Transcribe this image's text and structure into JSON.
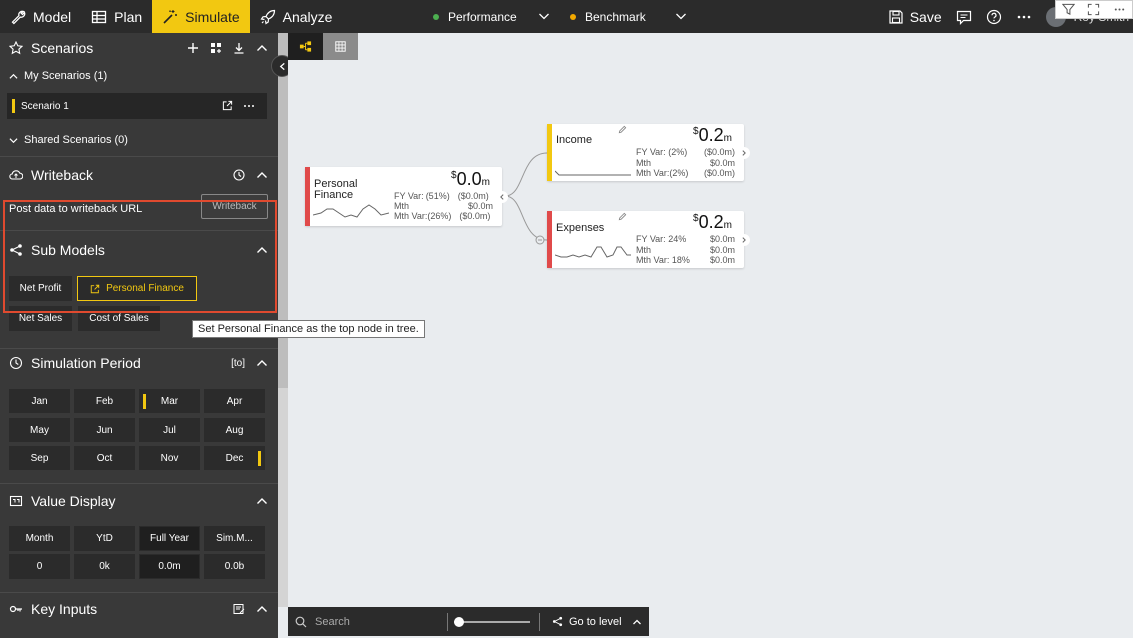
{
  "topnav": {
    "model_label": "Model",
    "plan_label": "Plan",
    "simulate_label": "Simulate",
    "analyze_label": "Analyze",
    "performance_label": "Performance",
    "benchmark_label": "Benchmark",
    "save_label": "Save",
    "user_name": "Roy Smith"
  },
  "colors": {
    "accent": "#f2c811",
    "sidebar": "#393939",
    "topbar": "#2b2b2b",
    "canvas": "#e9ecef",
    "expense": "#e04a4a",
    "income": "#f2c811",
    "performance_dot": "#4caf50",
    "benchmark_dot": "#f2a900"
  },
  "sidebar": {
    "scenarios_title": "Scenarios",
    "my_scenarios": "My Scenarios (1)",
    "scenario_1": "Scenario 1",
    "shared_scenarios": "Shared Scenarios (0)",
    "writeback_title": "Writeback",
    "writeback_desc": "Post data to writeback URL",
    "writeback_button": "Writeback",
    "submodels_title": "Sub Models",
    "submodels": [
      "Net Profit",
      "Personal Finance",
      "Net Sales",
      "Cost of Sales"
    ],
    "tooltip": "Set Personal Finance as the top node in tree.",
    "simulation_title": "Simulation Period",
    "simulation_tag": "[to]",
    "months": [
      "Jan",
      "Feb",
      "Mar",
      "Apr",
      "May",
      "Jun",
      "Jul",
      "Aug",
      "Sep",
      "Oct",
      "Nov",
      "Dec"
    ],
    "value_display_title": "Value Display",
    "value_display_headers": [
      "Month",
      "YtD",
      "Full Year",
      "Sim.M..."
    ],
    "value_display_values": [
      "0",
      "0k",
      "0.0m",
      "0.0b"
    ],
    "key_inputs_title": "Key Inputs"
  },
  "nodes": {
    "personal_finance": {
      "name_line1": "Personal",
      "name_line2": "Finance",
      "value": "0.0",
      "unit": "m",
      "currency": "$",
      "fy_label": "FY Var:",
      "fy_pct": "(51%)",
      "fy_val": "($0.0m)",
      "mth_label": "Mth",
      "mth_val": "$0.0m",
      "mthvar_label": "Mth Var:",
      "mthvar_pct": "(26%)",
      "mthvar_val": "($0.0m)"
    },
    "income": {
      "name": "Income",
      "value": "0.2",
      "unit": "m",
      "currency": "$",
      "fy_label": "FY Var:",
      "fy_pct": "(2%)",
      "fy_val": "($0.0m)",
      "mth_label": "Mth",
      "mth_val": "$0.0m",
      "mthvar_label": "Mth Var:",
      "mthvar_pct": "(2%)",
      "mthvar_val": "($0.0m)"
    },
    "expenses": {
      "name": "Expenses",
      "value": "0.2",
      "unit": "m",
      "currency": "$",
      "fy_label": "FY Var:",
      "fy_pct": "24%",
      "fy_val": "$0.0m",
      "mth_label": "Mth",
      "mth_val": "$0.0m",
      "mthvar_label": "Mth Var:",
      "mthvar_pct": "18%",
      "mthvar_val": "$0.0m"
    }
  },
  "bottombar": {
    "search_placeholder": "Search",
    "zoom_level": 0,
    "go_to_level": "Go to level"
  },
  "icons": [
    "wrench-icon",
    "table-icon",
    "magic-wand-icon",
    "rocket-icon",
    "save-icon",
    "comment-icon",
    "help-icon",
    "more-icon",
    "filter-icon",
    "expand-icon",
    "star-icon",
    "plus-icon",
    "grid-add-icon",
    "download-icon",
    "chevron-up-icon",
    "cloud-icon",
    "history-icon",
    "share-icon",
    "edit-icon",
    "sub-model-icon",
    "clock-icon",
    "value-icon",
    "key-input-icon",
    "search-icon",
    "tree-icon"
  ]
}
